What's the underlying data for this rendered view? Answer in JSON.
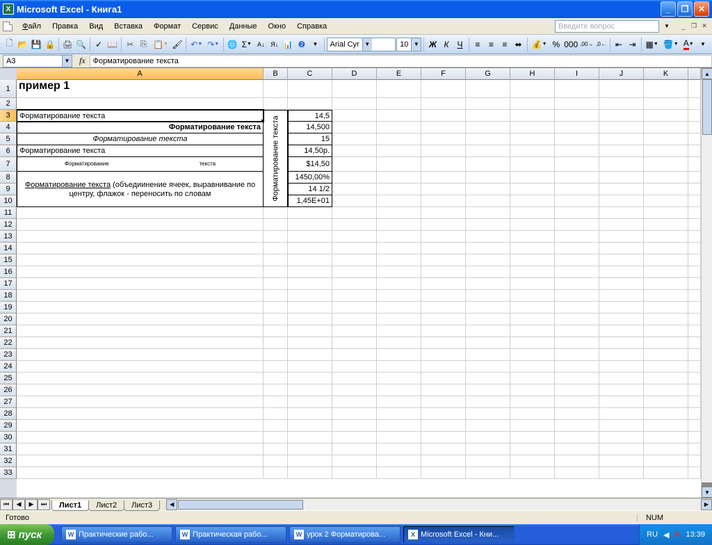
{
  "title": "Microsoft Excel - Книга1",
  "menu": {
    "file": "Файл",
    "edit": "Правка",
    "view": "Вид",
    "insert": "Вставка",
    "format": "Формат",
    "tools": "Сервис",
    "data": "Данные",
    "window": "Окно",
    "help": "Справка"
  },
  "help_placeholder": "Введите вопрос",
  "toolbar": {
    "font": "Arial Cyr",
    "size": "10",
    "bold": "Ж",
    "italic": "К",
    "underline": "Ч"
  },
  "namebox": "A3",
  "formula": "Форматирование текста",
  "columns": [
    "A",
    "B",
    "C",
    "D",
    "E",
    "F",
    "G",
    "H",
    "I",
    "J",
    "K"
  ],
  "col_widths": {
    "A": 355,
    "B": 35,
    "std": 64
  },
  "selected_col": "A",
  "selected_row": 3,
  "rows_visible": 33,
  "cells": {
    "A1": "пример 1",
    "A3": "Форматирование текста",
    "A4": "Форматирование текста",
    "A5": "Форматирование текста",
    "A6": "Форматирование текста",
    "A7a": "Форматирование",
    "A7b": "текста",
    "A8": "Форматирование текста",
    "A8rest": " (объедиинение ячеек, выравнивание по центру, флажок - переносить по словам",
    "B_merged": "Форматирование текста",
    "C3": "14,5",
    "C4": "14,500",
    "C5": "15",
    "C6": "14,50р.",
    "C7": "$14,50",
    "C8": "1450,00%",
    "C9": "14 1/2",
    "C10": "1,45E+01"
  },
  "sheets": {
    "s1": "Лист1",
    "s2": "Лист2",
    "s3": "Лист3"
  },
  "status": {
    "ready": "Готово",
    "num": "NUM"
  },
  "taskbar": {
    "start": "пуск",
    "t1": "Практические рабо...",
    "t2": "Практическая рабо...",
    "t3": "урок 2 Форматирова...",
    "t4": "Microsoft Excel - Кни...",
    "lang": "RU",
    "time": "13:39"
  }
}
